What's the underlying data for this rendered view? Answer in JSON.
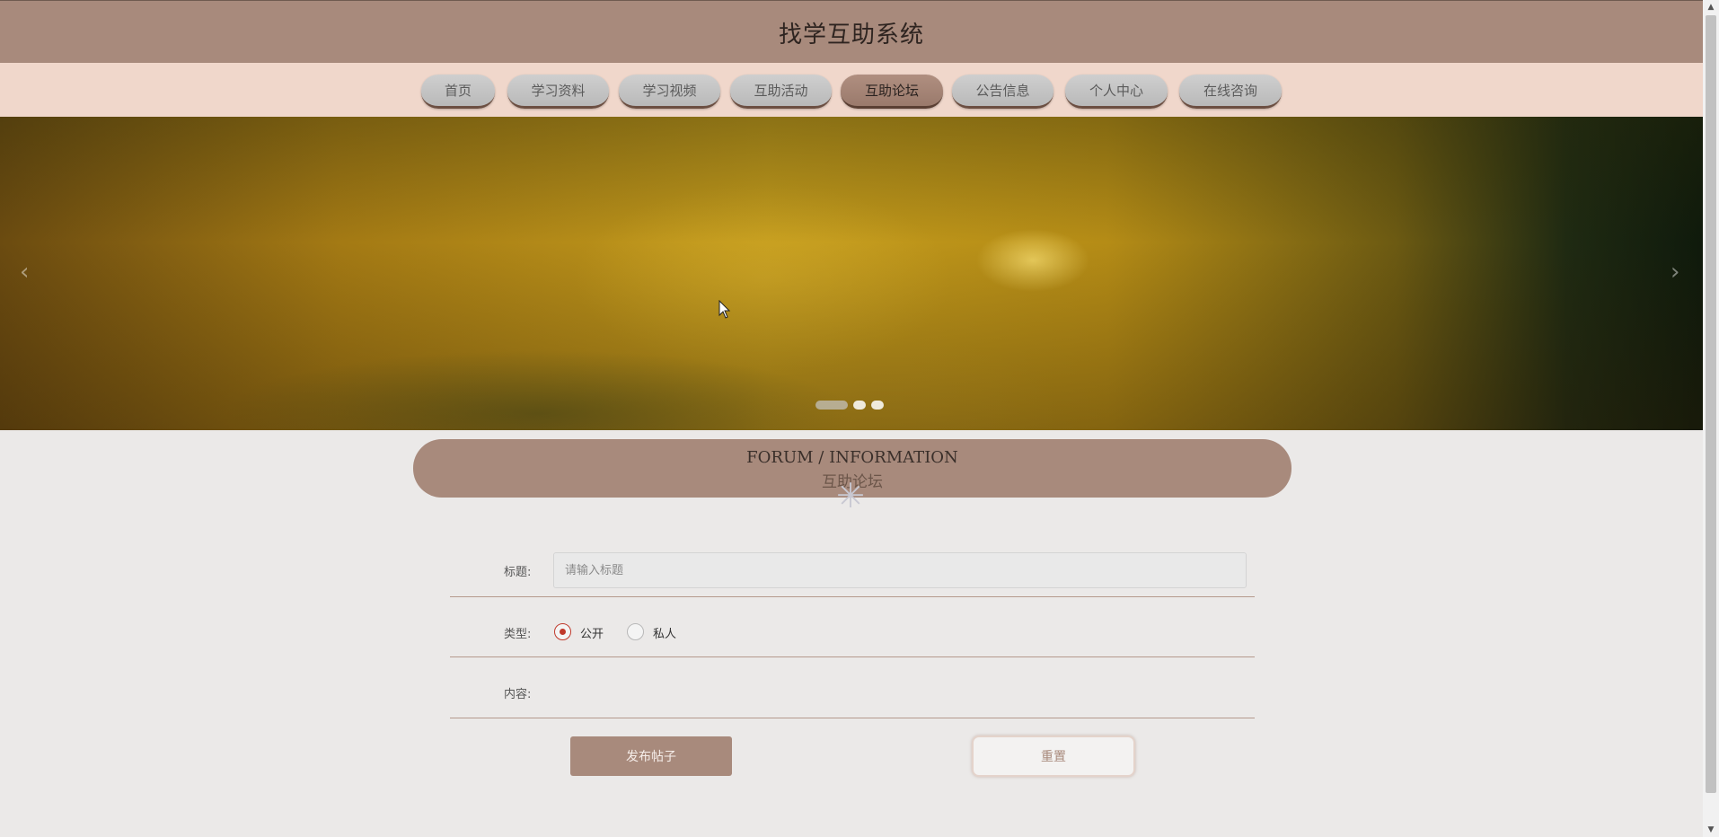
{
  "header": {
    "title": "找学互助系统"
  },
  "nav": {
    "items": [
      {
        "label": "首页"
      },
      {
        "label": "学习资料"
      },
      {
        "label": "学习视频"
      },
      {
        "label": "互助活动"
      },
      {
        "label": "互助论坛",
        "active": true
      },
      {
        "label": "公告信息"
      },
      {
        "label": "个人中心"
      },
      {
        "label": "在线咨询"
      }
    ]
  },
  "banner": {
    "prev_icon": "chevron-left-icon",
    "next_icon": "chevron-right-icon",
    "prev_glyph": "‹",
    "next_glyph": "›",
    "slide_count": 3,
    "active_slide": 1
  },
  "section": {
    "title_en": "FORUM / INFORMATION",
    "title_cn": "互助论坛",
    "loading_glyph": "✳"
  },
  "form": {
    "title_label": "标题:",
    "title_placeholder": "请输入标题",
    "title_value": "",
    "type_label": "类型:",
    "type_options": [
      {
        "label": "公开",
        "checked": true
      },
      {
        "label": "私人",
        "checked": false
      }
    ],
    "content_label": "内容:",
    "submit_label": "发布帖子",
    "reset_label": "重置"
  },
  "colors": {
    "header_bg": "#a88a7c",
    "nav_bg": "#f0d7cb",
    "page_bg": "#ebe9e8",
    "radio_accent": "#c0392b"
  }
}
